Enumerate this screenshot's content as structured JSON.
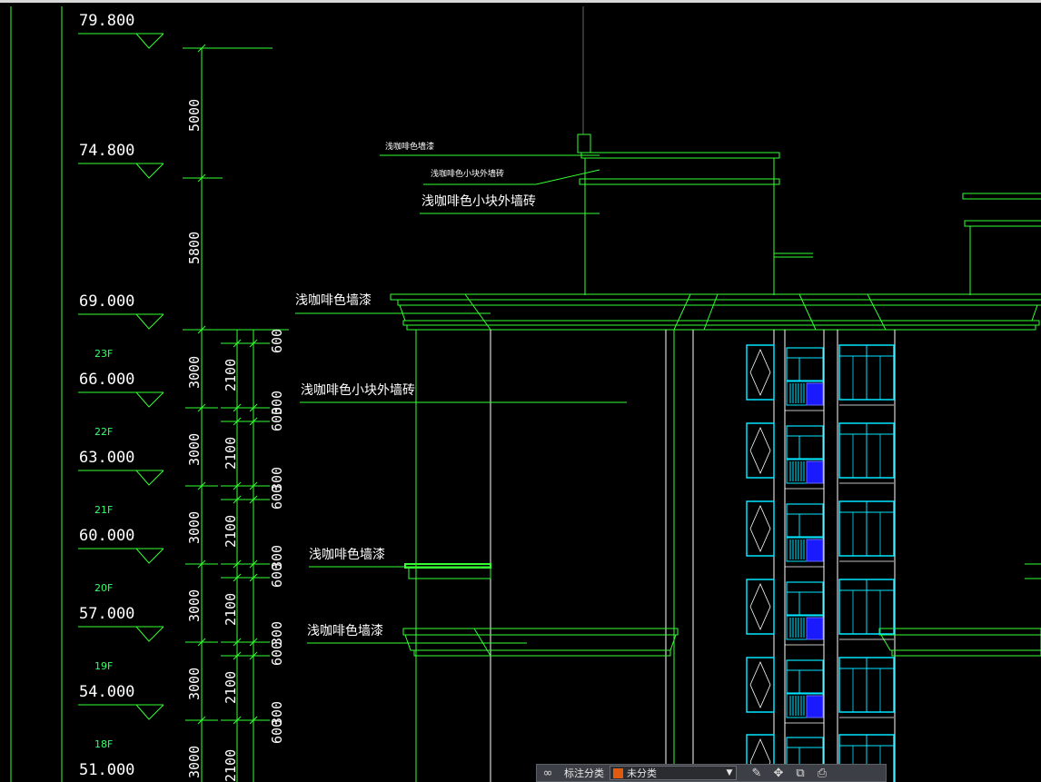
{
  "drawing": {
    "levels": [
      {
        "value": "79.800"
      },
      {
        "value": "74.800"
      },
      {
        "value": "69.000",
        "floor": "23F"
      },
      {
        "value": "66.000",
        "floor": "22F"
      },
      {
        "value": "63.000",
        "floor": "21F"
      },
      {
        "value": "60.000",
        "floor": "20F"
      },
      {
        "value": "57.000",
        "floor": "19F"
      },
      {
        "value": "54.000",
        "floor": "18F"
      },
      {
        "value": "51.000"
      }
    ],
    "dims_outer": [
      "5000",
      "5800",
      "3000",
      "3000",
      "3000",
      "3000",
      "3000",
      "3000"
    ],
    "dims_inner": [
      "2100",
      "2100",
      "2100",
      "2100",
      "2100",
      "2100"
    ],
    "dims_right": [
      "600",
      "300",
      "600",
      "300",
      "600",
      "300",
      "600",
      "300",
      "600",
      "300",
      "600"
    ],
    "notes": {
      "paint_small": "浅咖啡色墙漆",
      "tile_small": "浅咖啡色小块外墙砖",
      "tile_roof": "浅咖啡色小块外墙砖",
      "paint_roof": "浅咖啡色墙漆",
      "tile_wall": "浅咖啡色小块外墙砖",
      "paint_band_1": "浅咖啡色墙漆",
      "paint_band_2": "浅咖啡色墙漆"
    },
    "colors": {
      "line_green": "#33ff33",
      "text_white": "#ffffff",
      "window_cyan": "#00e5ff",
      "rail_blue": "#1a1aff"
    }
  },
  "toolbar": {
    "icons": [
      "bind-icon",
      "annotate-icon",
      "move-icon",
      "copy-icon",
      "paste-icon"
    ],
    "label": "标注分类",
    "selected": "未分类",
    "selected_color": "#e05a10"
  }
}
